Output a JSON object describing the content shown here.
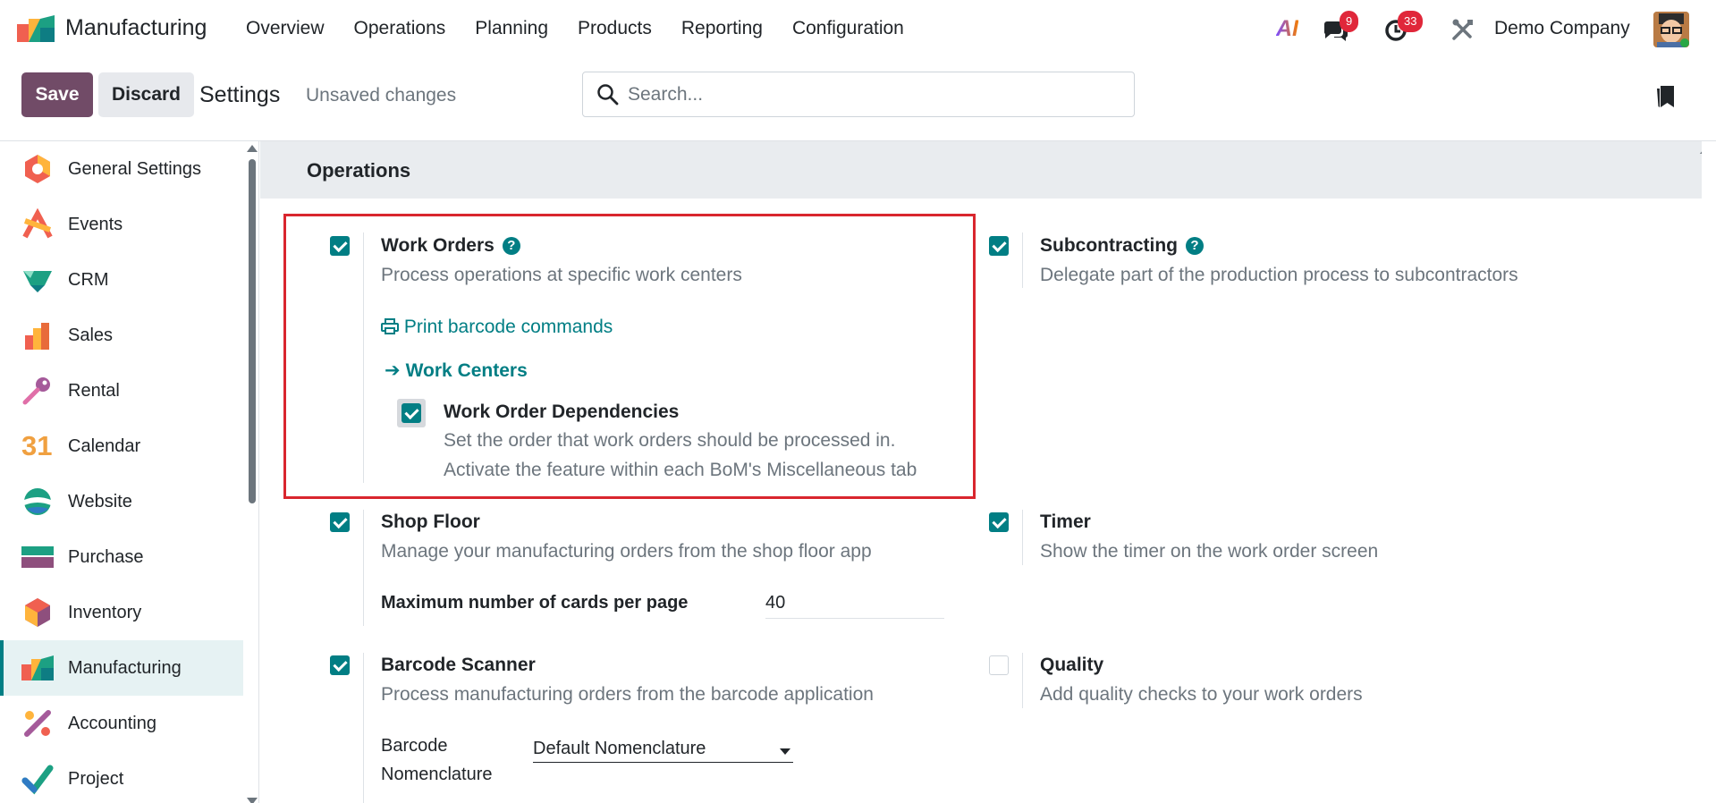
{
  "app": {
    "name": "Manufacturing"
  },
  "nav": {
    "menu": [
      "Overview",
      "Operations",
      "Planning",
      "Products",
      "Reporting",
      "Configuration"
    ]
  },
  "systray": {
    "ai_label": "AI",
    "chat_count": "9",
    "activity_count": "33",
    "company": "Demo Company"
  },
  "control": {
    "save_label": "Save",
    "discard_label": "Discard",
    "title": "Settings",
    "status": "Unsaved changes",
    "search_placeholder": "Search..."
  },
  "sidebar": {
    "items": [
      {
        "label": "General Settings",
        "icon": "gear-hexagon-icon"
      },
      {
        "label": "Events",
        "icon": "events-icon"
      },
      {
        "label": "CRM",
        "icon": "crm-icon"
      },
      {
        "label": "Sales",
        "icon": "sales-icon"
      },
      {
        "label": "Rental",
        "icon": "rental-key-icon"
      },
      {
        "label": "Calendar",
        "icon": "calendar-icon"
      },
      {
        "label": "Website",
        "icon": "website-icon"
      },
      {
        "label": "Purchase",
        "icon": "purchase-icon"
      },
      {
        "label": "Inventory",
        "icon": "inventory-icon"
      },
      {
        "label": "Manufacturing",
        "icon": "manufacturing-icon",
        "active": true
      },
      {
        "label": "Accounting",
        "icon": "accounting-icon"
      },
      {
        "label": "Project",
        "icon": "project-icon"
      }
    ]
  },
  "calendar_icon_text": "31",
  "section": {
    "title": "Operations"
  },
  "settings": {
    "work_orders": {
      "title": "Work Orders",
      "desc": "Process operations at specific work centers",
      "checked": true,
      "print_link": "Print barcode commands",
      "centers_link": "Work Centers",
      "dependencies": {
        "title": "Work Order Dependencies",
        "desc1": "Set the order that work orders should be processed in.",
        "desc2": "Activate the feature within each BoM's Miscellaneous tab",
        "checked": true
      }
    },
    "subcontracting": {
      "title": "Subcontracting",
      "desc": "Delegate part of the production process to subcontractors",
      "checked": true
    },
    "shop_floor": {
      "title": "Shop Floor",
      "desc": "Manage your manufacturing orders from the shop floor app",
      "checked": true,
      "max_cards_label": "Maximum number of cards per page",
      "max_cards_value": "40"
    },
    "timer": {
      "title": "Timer",
      "desc": "Show the timer on the work order screen",
      "checked": true
    },
    "barcode": {
      "title": "Barcode Scanner",
      "desc": "Process manufacturing orders from the barcode application",
      "checked": true,
      "nomenclature_label_1": "Barcode",
      "nomenclature_label_2": "Nomenclature",
      "nomenclature_value": "Default Nomenclature"
    },
    "quality": {
      "title": "Quality",
      "desc": "Add quality checks to your work orders",
      "checked": false
    }
  },
  "colors": {
    "brand": "#714b67",
    "accent": "#017e84",
    "highlight": "#d9262e"
  }
}
